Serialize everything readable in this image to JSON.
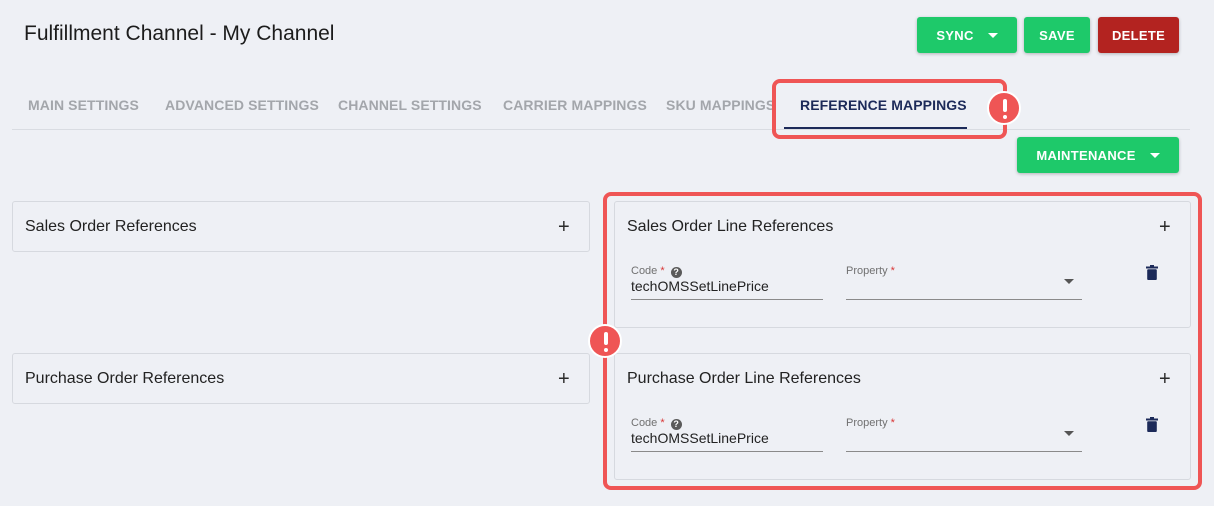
{
  "header": {
    "title": "Fulfillment Channel - My Channel",
    "sync_label": "SYNC",
    "save_label": "SAVE",
    "delete_label": "DELETE"
  },
  "tabs": [
    {
      "label": "MAIN SETTINGS",
      "active": false
    },
    {
      "label": "ADVANCED SETTINGS",
      "active": false
    },
    {
      "label": "CHANNEL SETTINGS",
      "active": false
    },
    {
      "label": "CARRIER MAPPINGS",
      "active": false
    },
    {
      "label": "SKU MAPPINGS",
      "active": false
    },
    {
      "label": "REFERENCE MAPPINGS",
      "active": true
    }
  ],
  "toolbar": {
    "maintenance_label": "MAINTENANCE"
  },
  "panels": {
    "sales_order": {
      "title": "Sales Order References"
    },
    "purchase_order": {
      "title": "Purchase Order References"
    },
    "sales_order_line": {
      "title": "Sales Order Line References",
      "code_label": "Code",
      "code_value": "techOMSSetLinePrice",
      "property_label": "Property",
      "property_value": ""
    },
    "purchase_order_line": {
      "title": "Purchase Order Line References",
      "code_label": "Code",
      "code_value": "techOMSSetLinePrice",
      "property_label": "Property",
      "property_value": ""
    }
  },
  "colors": {
    "primary_green": "#1ec96a",
    "danger_red": "#b32320",
    "highlight_red": "#ef5555",
    "active_tab": "#1c2a59"
  }
}
